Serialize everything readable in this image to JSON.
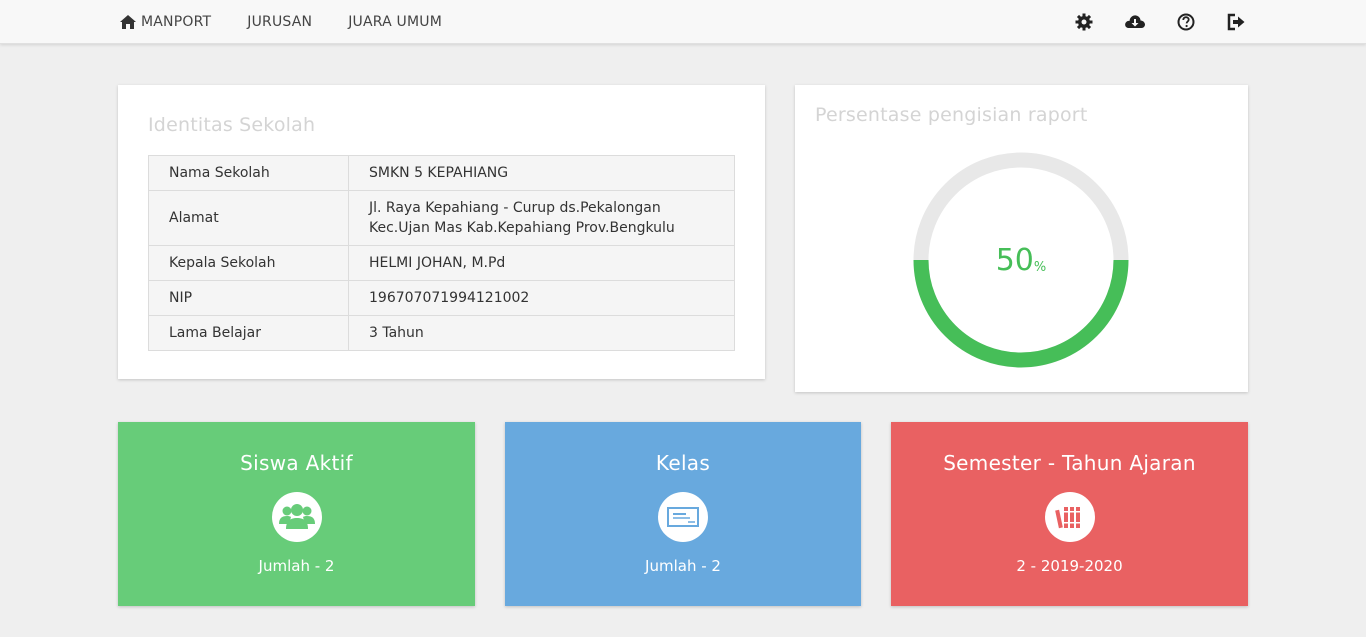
{
  "navbar": {
    "brand": "MANPORT",
    "links": [
      "JURUSAN",
      "JUARA UMUM"
    ],
    "icons": [
      "gear-icon",
      "cloud-download-icon",
      "help-circle-icon",
      "logout-icon"
    ]
  },
  "identity": {
    "title": "Identitas Sekolah",
    "rows": [
      {
        "label": "Nama Sekolah",
        "value": "SMKN 5 KEPAHIANG"
      },
      {
        "label": "Alamat",
        "value": "Jl. Raya Kepahiang - Curup ds.Pekalongan Kec.Ujan Mas Kab.Kepahiang Prov.Bengkulu"
      },
      {
        "label": "Kepala Sekolah",
        "value": "HELMI JOHAN, M.Pd"
      },
      {
        "label": "NIP",
        "value": "196707071994121002"
      },
      {
        "label": "Lama Belajar",
        "value": "3 Tahun"
      }
    ]
  },
  "progress": {
    "title": "Persentase pengisian raport",
    "value": "50",
    "unit": "%",
    "fraction": 0.5,
    "color": "#46be58",
    "track_color": "#e8e8e8"
  },
  "stats": {
    "siswa": {
      "title": "Siswa Aktif",
      "caption": "Jumlah - 2",
      "icon": "users-group-icon",
      "color": "#67cc79"
    },
    "kelas": {
      "title": "Kelas",
      "caption": "Jumlah - 2",
      "icon": "classroom-board-icon",
      "color": "#68a9de"
    },
    "semester": {
      "title": "Semester - Tahun Ajaran",
      "caption": "2 - 2019-2020",
      "icon": "books-icon",
      "color": "#e96162"
    }
  }
}
